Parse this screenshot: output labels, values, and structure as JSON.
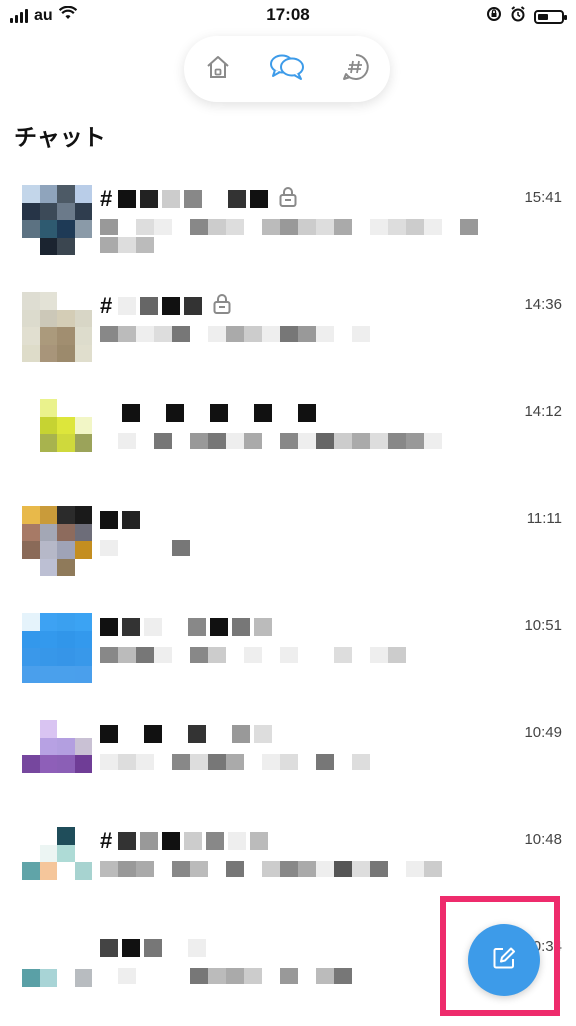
{
  "status_bar": {
    "carrier": "au",
    "time": "17:08",
    "battery_level": 0.45
  },
  "nav": {
    "items": [
      {
        "name": "home",
        "icon": "home-icon",
        "active": false
      },
      {
        "name": "chat",
        "icon": "chat-bubbles-icon",
        "active": true
      },
      {
        "name": "channels",
        "icon": "hashtag-bubble-icon",
        "active": false
      }
    ]
  },
  "page_title": "チャット",
  "colors": {
    "accent": "#3d9be9",
    "highlight_frame": "#ee2b6c"
  },
  "chats": [
    {
      "has_hash": true,
      "locked": true,
      "time": "15:41",
      "avatar": [
        "#c3d6ea",
        "#8fa4bc",
        "#4d5a66",
        "#b9cde8",
        "#263447",
        "#3c4a58",
        "#6b7a8a",
        "#2f3d4e",
        "#5c7282",
        "#2e5a70",
        "#1e3a56",
        "#8a9aa8",
        "#ffffff",
        "#1b2430",
        "#3b4650",
        "#ffffff"
      ],
      "name": [
        "#111",
        "#222",
        "#ccc",
        "#888",
        "#fff",
        "#333",
        "#111"
      ],
      "preview": [
        "#999",
        "#fff",
        "#ddd",
        "#eee",
        "#fff",
        "#888",
        "#ccc",
        "#ddd",
        "#fff",
        "#bbb",
        "#999",
        "#ccc",
        "#ddd",
        "#aaa",
        "#fff",
        "#eee",
        "#ddd",
        "#ccc",
        "#eee",
        "#fff",
        "#999",
        "#aaa",
        "#ddd",
        "#bbb"
      ]
    },
    {
      "has_hash": true,
      "locked": true,
      "time": "14:36",
      "avatar": [
        "#deddd2",
        "#e3e2d6",
        "#ffffff",
        "#ffffff",
        "#dcdbcd",
        "#ccc8b8",
        "#d4cdb6",
        "#d8d6c6",
        "#e1dfd0",
        "#ab9a7c",
        "#a18e70",
        "#dddccc",
        "#dedcc9",
        "#a8957a",
        "#9c8a6c",
        "#e0decd"
      ],
      "name": [
        "#eee",
        "#666",
        "#111",
        "#333"
      ],
      "preview": [
        "#888",
        "#bbb",
        "#eee",
        "#ddd",
        "#777",
        "#fff",
        "#eee",
        "#aaa",
        "#ccc",
        "#eee",
        "#777",
        "#999",
        "#eee",
        "#fff",
        "#eee"
      ]
    },
    {
      "has_hash": false,
      "locked": false,
      "time": "14:12",
      "avatar": [
        "#ffffff",
        "#eaf28c",
        "#ffffff",
        "#ffffff",
        "#ffffff",
        "#c6d332",
        "#dde63b",
        "#f2f6c6",
        "#ffffff",
        "#a8b34e",
        "#cfd93c",
        "#9ba35a",
        "#ffffff",
        "#ffffff",
        "#ffffff",
        "#ffffff"
      ],
      "name": [
        "#fff",
        "#111",
        "#fff",
        "#111",
        "#fff",
        "#111",
        "#fff",
        "#111",
        "#fff",
        "#111"
      ],
      "preview": [
        "#fff",
        "#eee",
        "#fff",
        "#777",
        "#fff",
        "#999",
        "#777",
        "#eee",
        "#aaa",
        "#fff",
        "#888",
        "#eee",
        "#666",
        "#ccc",
        "#aaa",
        "#ddd",
        "#888",
        "#999",
        "#eee"
      ]
    },
    {
      "has_hash": false,
      "locked": false,
      "time": "11:11",
      "avatar": [
        "#e8b94a",
        "#c99b3a",
        "#2b2b2b",
        "#1a1a1a",
        "#a77a66",
        "#a3a7b5",
        "#8d6b5d",
        "#6d6d79",
        "#8a6a58",
        "#b6b8c8",
        "#9fa3b7",
        "#c48e20",
        "#ffffff",
        "#bcbfd3",
        "#8f7a5a",
        "#ffffff"
      ],
      "name": [
        "#111",
        "#222"
      ],
      "preview": [
        "#eee",
        "#fff",
        "#fff",
        "#fff",
        "#777"
      ]
    },
    {
      "has_hash": false,
      "locked": false,
      "time": "10:51",
      "avatar": [
        "#e5f3fb",
        "#3da2f3",
        "#3aa0f0",
        "#3ba3f3",
        "#3398ec",
        "#3399ed",
        "#3196ea",
        "#3399ed",
        "#3a98ea",
        "#3797e9",
        "#3695e8",
        "#3898ea",
        "#4a9fec",
        "#4aa0ec",
        "#4aa0ec",
        "#4a9fec"
      ],
      "name": [
        "#111",
        "#333",
        "#eee",
        "#fff",
        "#888",
        "#111",
        "#777",
        "#bbb"
      ],
      "preview": [
        "#888",
        "#bbb",
        "#777",
        "#eee",
        "#fff",
        "#888",
        "#ccc",
        "#fff",
        "#eee",
        "#fff",
        "#eee",
        "#fff",
        "#fff",
        "#ddd",
        "#fff",
        "#eee",
        "#ccc"
      ]
    },
    {
      "has_hash": false,
      "locked": false,
      "time": "10:49",
      "avatar": [
        "#ffffff",
        "#d9c4f2",
        "#ffffff",
        "#ffffff",
        "#ffffff",
        "#b7a1e3",
        "#b39fe0",
        "#c9c1d4",
        "#76479e",
        "#8e5fb8",
        "#8b5fb6",
        "#6f3d96",
        "#ffffff",
        "#ffffff",
        "#ffffff",
        "#ffffff"
      ],
      "name": [
        "#111",
        "#fff",
        "#111",
        "#fff",
        "#333",
        "#fff",
        "#999",
        "#ddd"
      ],
      "preview": [
        "#eee",
        "#ddd",
        "#eee",
        "#fff",
        "#888",
        "#ddd",
        "#777",
        "#aaa",
        "#fff",
        "#eee",
        "#ddd",
        "#fff",
        "#777",
        "#fff",
        "#ddd"
      ]
    },
    {
      "has_hash": true,
      "locked": false,
      "time": "10:48",
      "avatar": [
        "#ffffff",
        "#ffffff",
        "#1f4d5a",
        "#ffffff",
        "#ffffff",
        "#ecf5f3",
        "#aedbd6",
        "#ffffff",
        "#60a4a8",
        "#f5c69b",
        "#ffffff",
        "#a7d3d0",
        "#ffffff",
        "#ffffff",
        "#ffffff",
        "#ffffff"
      ],
      "name": [
        "#333",
        "#999",
        "#111",
        "#ccc",
        "#888",
        "#eee",
        "#bbb"
      ],
      "preview": [
        "#bbb",
        "#999",
        "#aaa",
        "#fff",
        "#888",
        "#bbb",
        "#fff",
        "#777",
        "#fff",
        "#ccc",
        "#888",
        "#aaa",
        "#eee",
        "#555",
        "#ddd",
        "#777",
        "#fff",
        "#eee",
        "#ccc"
      ]
    },
    {
      "has_hash": false,
      "locked": false,
      "time": "10:34",
      "avatar": [
        "#ffffff",
        "#ffffff",
        "#ffffff",
        "#ffffff",
        "#ffffff",
        "#ffffff",
        "#ffffff",
        "#ffffff",
        "#5aa0a6",
        "#a8d4d6",
        "#ffffff",
        "#b8bcc0",
        "#ffffff",
        "#ffffff",
        "#ffffff",
        "#ffffff"
      ],
      "name": [
        "#444",
        "#111",
        "#777",
        "#fff",
        "#eee"
      ],
      "preview": [
        "#fff",
        "#eee",
        "#fff",
        "#fff",
        "#fff",
        "#777",
        "#bbb",
        "#aaa",
        "#ccc",
        "#fff",
        "#999",
        "#fff",
        "#bbb",
        "#777"
      ]
    }
  ],
  "compose_button": {
    "icon": "compose-icon"
  }
}
